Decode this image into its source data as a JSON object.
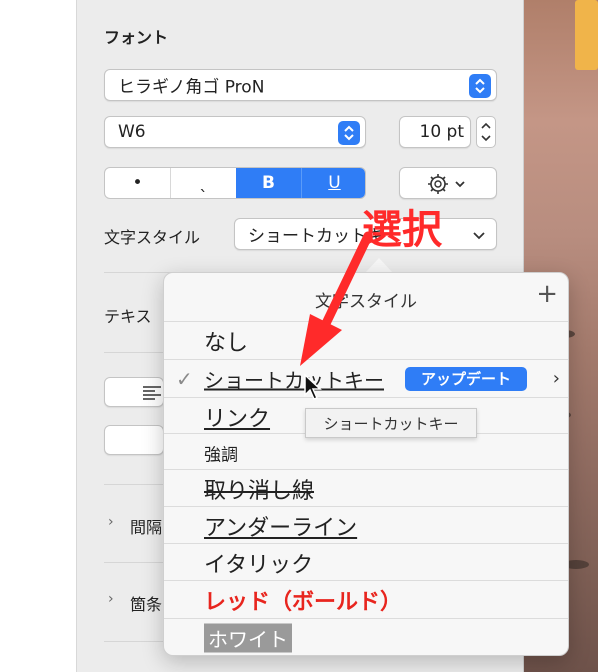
{
  "sidebar": {
    "font_section_title": "フォント",
    "font_family": "ヒラギノ角ゴ ProN",
    "font_weight": "W6",
    "font_size": "10 pt",
    "style_buttons": [
      "•",
      "ˎ",
      "B",
      "U"
    ],
    "char_style_label": "文字スタイル",
    "char_style_value": "ショートカットキー",
    "text_label_partial": "テキス",
    "spacing_label_partial": "間隔",
    "bullets_label_partial": "箇条"
  },
  "popover": {
    "title": "文字スタイル",
    "add_label": "+",
    "update_label": "アップデート",
    "styles": [
      {
        "label": "なし",
        "style": "plain"
      },
      {
        "label": "ショートカットキー",
        "style": "underline",
        "checked": true
      },
      {
        "label": "リンク",
        "style": "underline"
      },
      {
        "label": "強調",
        "style": "small"
      },
      {
        "label": "取り消し線",
        "style": "strike"
      },
      {
        "label": "アンダーライン",
        "style": "underline"
      },
      {
        "label": "イタリック",
        "style": "plain"
      },
      {
        "label": "レッド（ボールド）",
        "style": "red-bold"
      },
      {
        "label": "ホワイト",
        "style": "white-on-gray"
      }
    ]
  },
  "tooltip": "ショートカットキー",
  "annotation": "選択",
  "colors": {
    "accent": "#2f7df6",
    "annotation": "#ff2a2a",
    "red_style": "#e8251e"
  }
}
